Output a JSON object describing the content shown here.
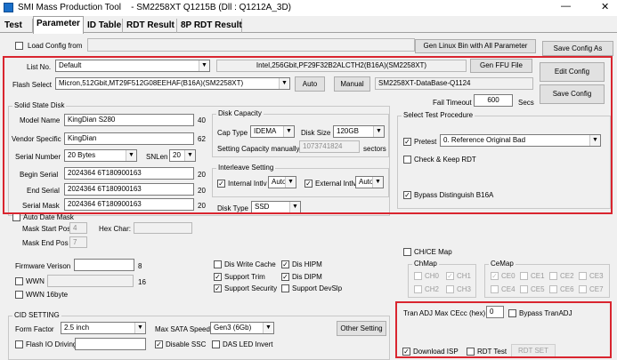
{
  "window": {
    "title": "SMI Mass Production Tool",
    "subtitle": "- SM2258XT    Q1215B    (Dll : Q1212A_3D)"
  },
  "tabs": [
    "Test",
    "Parameter",
    "ID Table",
    "RDT Result",
    "8P RDT Result"
  ],
  "colors": {
    "accent_red": "#d9252f"
  },
  "top": {
    "load_config_label": "Load Config from",
    "load_config_value": "",
    "gen_linux_label": "Gen Linux Bin with All Parameter",
    "save_config_as_label": "Save Config As"
  },
  "config": {
    "list_no_label": "List No.",
    "list_no_value": "Default",
    "list_info": "Intel,256Gbit,PF29F32B2ALCTH2(B16A)(SM2258XT)",
    "gen_ffu_label": "Gen FFU File",
    "edit_config_label": "Edit Config",
    "flash_select_label": "Flash Select",
    "flash_select_value": "Micron,512Gbit,MT29F512G08EEHAF(B16A)(SM2258XT)",
    "auto_label": "Auto",
    "manual_label": "Manual",
    "database_label": "SM2258XT-DataBase-Q1124",
    "save_config_label": "Save Config",
    "fail_timeout_label": "Fail Timeout",
    "fail_timeout_value": "600",
    "secs_label": "Secs"
  },
  "ssd": {
    "group_label": "Solid State Disk",
    "model_name_label": "Model Name",
    "model_name_value": "KingDian S280",
    "model_name_len": "40",
    "vendor_specific_label": "Vendor Specific",
    "vendor_specific_value": "KingDian",
    "vendor_specific_len": "62",
    "serial_number_label": "Serial Number",
    "serial_number_value": "20 Bytes",
    "snlen_label": "SNLen",
    "snlen_value": "20",
    "begin_serial_label": "Begin Serial",
    "begin_serial_value": "2024364 6T180900163",
    "begin_serial_len": "20",
    "end_serial_label": "End Serial",
    "end_serial_value": "2024364 6T180900163",
    "end_serial_len": "20",
    "serial_mask_label": "Serial Mask",
    "serial_mask_value": "2024364 6T180900163",
    "serial_mask_len": "20"
  },
  "disk_capacity": {
    "group_label": "Disk Capacity",
    "cap_type_label": "Cap Type",
    "cap_type_value": "IDEMA",
    "disk_size_label": "Disk Size",
    "disk_size_value": "120GB",
    "setting_capacity_label": "Setting Capacity manually",
    "setting_capacity_value": "1073741824",
    "sectors_label": "sectors"
  },
  "interleave": {
    "group_label": "Interleave Setting",
    "internal_label": "Internal Intlv",
    "internal_value": "Auto",
    "external_label": "External Intlv",
    "external_value": "Auto",
    "disk_type_label": "Disk Type",
    "disk_type_value": "SSD"
  },
  "select_test": {
    "group_label": "Select Test Procedure",
    "pretest_label": "Pretest",
    "pretest_value": "0. Reference Original Bad",
    "check_keep_label": "Check & Keep RDT",
    "bypass_label": "Bypass Distinguish B16A"
  },
  "mask": {
    "auto_date_label": "Auto Date Mask",
    "mask_start_label": "Mask Start Pos",
    "mask_start_value": "4",
    "hex_char_label": "Hex Char:",
    "mask_end_label": "Mask End Pos",
    "mask_end_value": "7"
  },
  "firmware": {
    "firmware_version_label": "Firmware Verison",
    "firmware_version_value": "",
    "firmware_version_len": "8",
    "wwn_label": "WWN",
    "wwn_value": "",
    "wwn_len": "16",
    "wwn16_label": "WWN 16byte"
  },
  "features": {
    "dis_write_cache": "Dis Write Cache",
    "support_trim": "Support Trim",
    "support_security": "Support Security",
    "dis_hipm": "Dis HIPM",
    "dis_dipm": "Dis DIPM",
    "support_devslp": "Support DevSlp"
  },
  "chce": {
    "map_label": "CH/CE Map",
    "chmap_label": "ChMap",
    "cemap_label": "CeMap",
    "ch": [
      "CH0",
      "CH1",
      "CH2",
      "CH3"
    ],
    "ce": [
      "CE0",
      "CE1",
      "CE2",
      "CE3",
      "CE4",
      "CE5",
      "CE6",
      "CE7"
    ]
  },
  "cid": {
    "group_label": "CID SETTING",
    "form_factor_label": "Form Factor",
    "form_factor_value": "2.5 inch",
    "max_sata_label": "Max SATA Speed",
    "max_sata_value": "Gen3 (6Gb)",
    "other_setting_label": "Other Setting",
    "flash_io_label": "Flash IO Driving",
    "disable_ssc_label": "Disable SSC",
    "das_led_label": "DAS LED Invert"
  },
  "tran": {
    "tran_adj_label": "Tran ADJ Max CEcc (hex)",
    "tran_adj_value": "0",
    "bypass_tranadj_label": "Bypass TranADJ",
    "download_isp_label": "Download ISP",
    "rdt_test_label": "RDT Test",
    "rdt_set_label": "RDT SET"
  }
}
